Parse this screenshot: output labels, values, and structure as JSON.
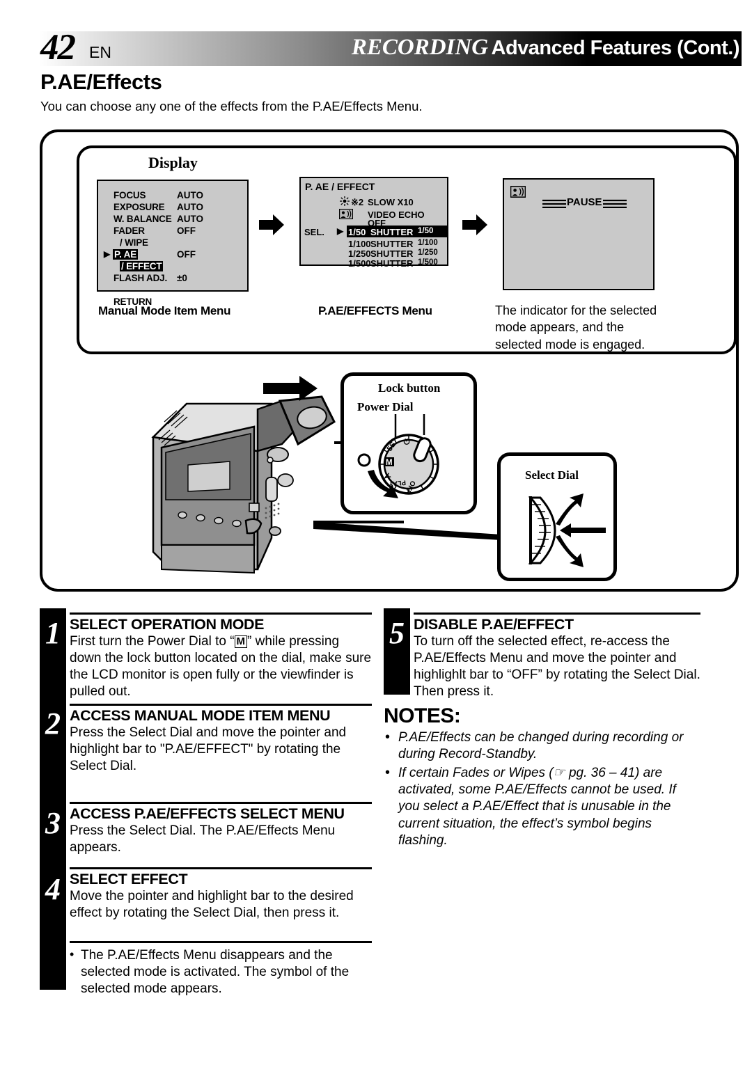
{
  "header": {
    "page_number": "42",
    "language": "EN",
    "title_italic": "RECORDING",
    "title_bold": "Advanced Features (Cont.)"
  },
  "section": {
    "title": "P.AE/Effects",
    "intro": "You can choose any one of the effects from the P.AE/Effects Menu."
  },
  "display_panel": {
    "label": "Display",
    "manual_menu": {
      "rows": [
        {
          "name": "FOCUS",
          "value": "AUTO"
        },
        {
          "name": "EXPOSURE",
          "value": "AUTO"
        },
        {
          "name": "W. BALANCE",
          "value": "AUTO"
        },
        {
          "name": "FADER",
          "value": "OFF"
        },
        {
          "name": "/ WIPE",
          "value": ""
        },
        {
          "name": "P. AE",
          "value": "OFF"
        },
        {
          "name": "/ EFFECT",
          "value": ""
        },
        {
          "name": "FLASH ADJ.",
          "value": "±0"
        },
        {
          "name": "RETURN",
          "value": ""
        }
      ],
      "pointer": "▶",
      "caption": "Manual Mode Item Menu"
    },
    "effects_menu": {
      "title": "P. AE / EFFECT",
      "sel_label": "SEL.",
      "pointer": "▶",
      "rows": [
        {
          "icon": "sun-icon",
          "icon_text": "※2",
          "label": "SLOW X10",
          "suffix": ""
        },
        {
          "icon": "video-echo-icon",
          "icon_text": "☰",
          "label": "VIDEO ECHO",
          "suffix": ""
        },
        {
          "icon": "",
          "icon_text": "",
          "label": "OFF",
          "suffix": ""
        },
        {
          "icon": "",
          "icon_text": "1/50",
          "label": "SHUTTER",
          "suffix": "1/50"
        },
        {
          "icon": "",
          "icon_text": "1/100",
          "label": "SHUTTER",
          "suffix": "1/100"
        },
        {
          "icon": "",
          "icon_text": "1/250",
          "label": "SHUTTER",
          "suffix": "1/250"
        },
        {
          "icon": "",
          "icon_text": "1/500",
          "label": "SHUTTER",
          "suffix": "1/500"
        }
      ],
      "caption": "P.AE/EFFECTS Menu"
    },
    "result_screen": {
      "pause_text": "PAUSE",
      "caption": "The indicator for the selected mode appears, and the selected mode is engaged."
    }
  },
  "callouts": {
    "lock_button": "Lock button",
    "power_dial": "Power Dial",
    "select_dial": "Select Dial",
    "power_dial_positions": [
      "⏻",
      "5S",
      "M",
      "A",
      "PLAY",
      "OFF"
    ]
  },
  "steps": [
    {
      "num": "1",
      "heading": "SELECT OPERATION MODE",
      "body_pre": "First turn the Power Dial to “",
      "body_glyph": "M",
      "body_post": "” while pressing down the lock button located on the dial, make sure the LCD monitor is open fully or the viewfinder is pulled out."
    },
    {
      "num": "2",
      "heading": "ACCESS MANUAL MODE ITEM MENU",
      "body": "Press the Select Dial and move the pointer and highlight bar to \"P.AE/EFFECT\" by rotating the Select Dial."
    },
    {
      "num": "3",
      "heading": "ACCESS P.AE/EFFECTS SELECT MENU",
      "body": "Press the Select Dial. The P.AE/Effects Menu appears."
    },
    {
      "num": "4",
      "heading": "SELECT EFFECT",
      "body": "Move the pointer and highlight bar to the desired effect by rotating the Select Dial, then press it."
    }
  ],
  "left_footnote": "The P.AE/Effects Menu disappears and the selected mode is activated. The symbol of the selected mode appears.",
  "step5": {
    "num": "5",
    "heading": "DISABLE P.AE/EFFECT",
    "body": "To turn off the selected effect, re-access the P.AE/Effects Menu and move the pointer and highlighlt bar to “OFF” by rotating the Select Dial. Then press it."
  },
  "notes": {
    "title": "NOTES:",
    "items": [
      "P.AE/Effects can be changed during recording or during Record-Standby.",
      "If certain Fades or Wipes (☞ pg. 36 – 41) are activated, some P.AE/Effects cannot be used. If you select a P.AE/Effect that is unusable in the current situation, the effect’s symbol begins flashing."
    ]
  },
  "colors": {
    "lcd_background": "#c9c9c9",
    "ink": "#000000",
    "paper": "#ffffff"
  }
}
